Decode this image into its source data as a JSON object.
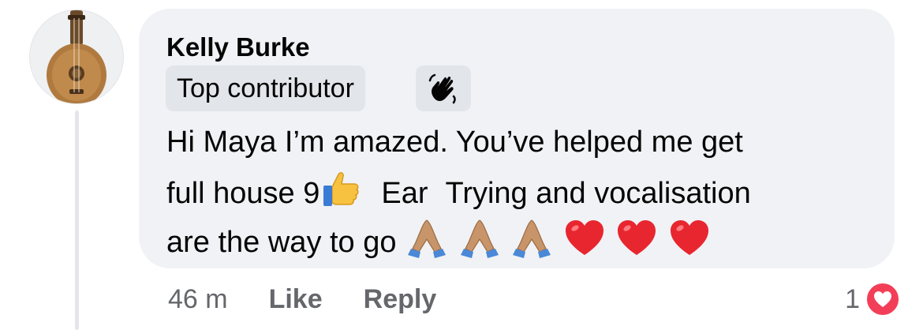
{
  "comment": {
    "author": "Kelly Burke",
    "badge_label": "Top contributor",
    "badge_icon": "waving-hand-icon",
    "text": {
      "line1": "Hi Maya I’m amazed. You’ve helped me get",
      "line2_a": "full house 9",
      "line2_b": "Ear",
      "line2_c": "Trying and vocalisation",
      "line3": "are the way to go"
    },
    "emojis": [
      "thumbs-up-icon",
      "folded-hands-icon",
      "folded-hands-icon",
      "folded-hands-icon",
      "red-heart-icon",
      "red-heart-icon",
      "red-heart-icon"
    ],
    "timestamp": "46 m",
    "like_label": "Like",
    "reply_label": "Reply",
    "reaction_count": "1",
    "reaction_icon": "love-reaction-icon"
  },
  "colors": {
    "bubble": "#f0f2f5",
    "badge_bg": "#e2e5e9",
    "secondary_text": "#65676b",
    "love": "#f33e58"
  }
}
